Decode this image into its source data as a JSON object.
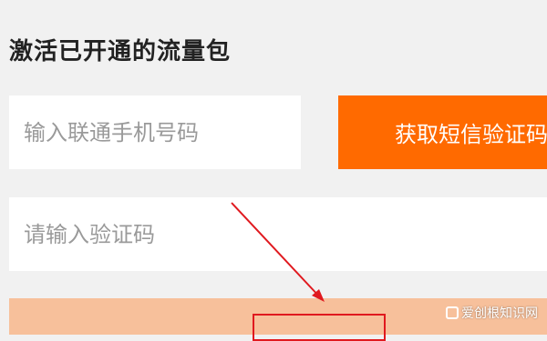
{
  "header": {
    "title": "激活已开通的流量包"
  },
  "form": {
    "phone_placeholder": "输入联通手机号码",
    "phone_value": "",
    "sms_button_label": "获取短信验证码",
    "code_placeholder": "请输入验证码",
    "code_value": "",
    "activate_label": ""
  },
  "annotation": {
    "arrow_color": "#e0191f",
    "box_color": "#e0191f"
  },
  "watermark": {
    "text": "爱创根知识网"
  },
  "colors": {
    "background": "#f1f1f1",
    "accent": "#ff6a00",
    "activate_button": "#f7c09b",
    "field": "#ffffff"
  }
}
